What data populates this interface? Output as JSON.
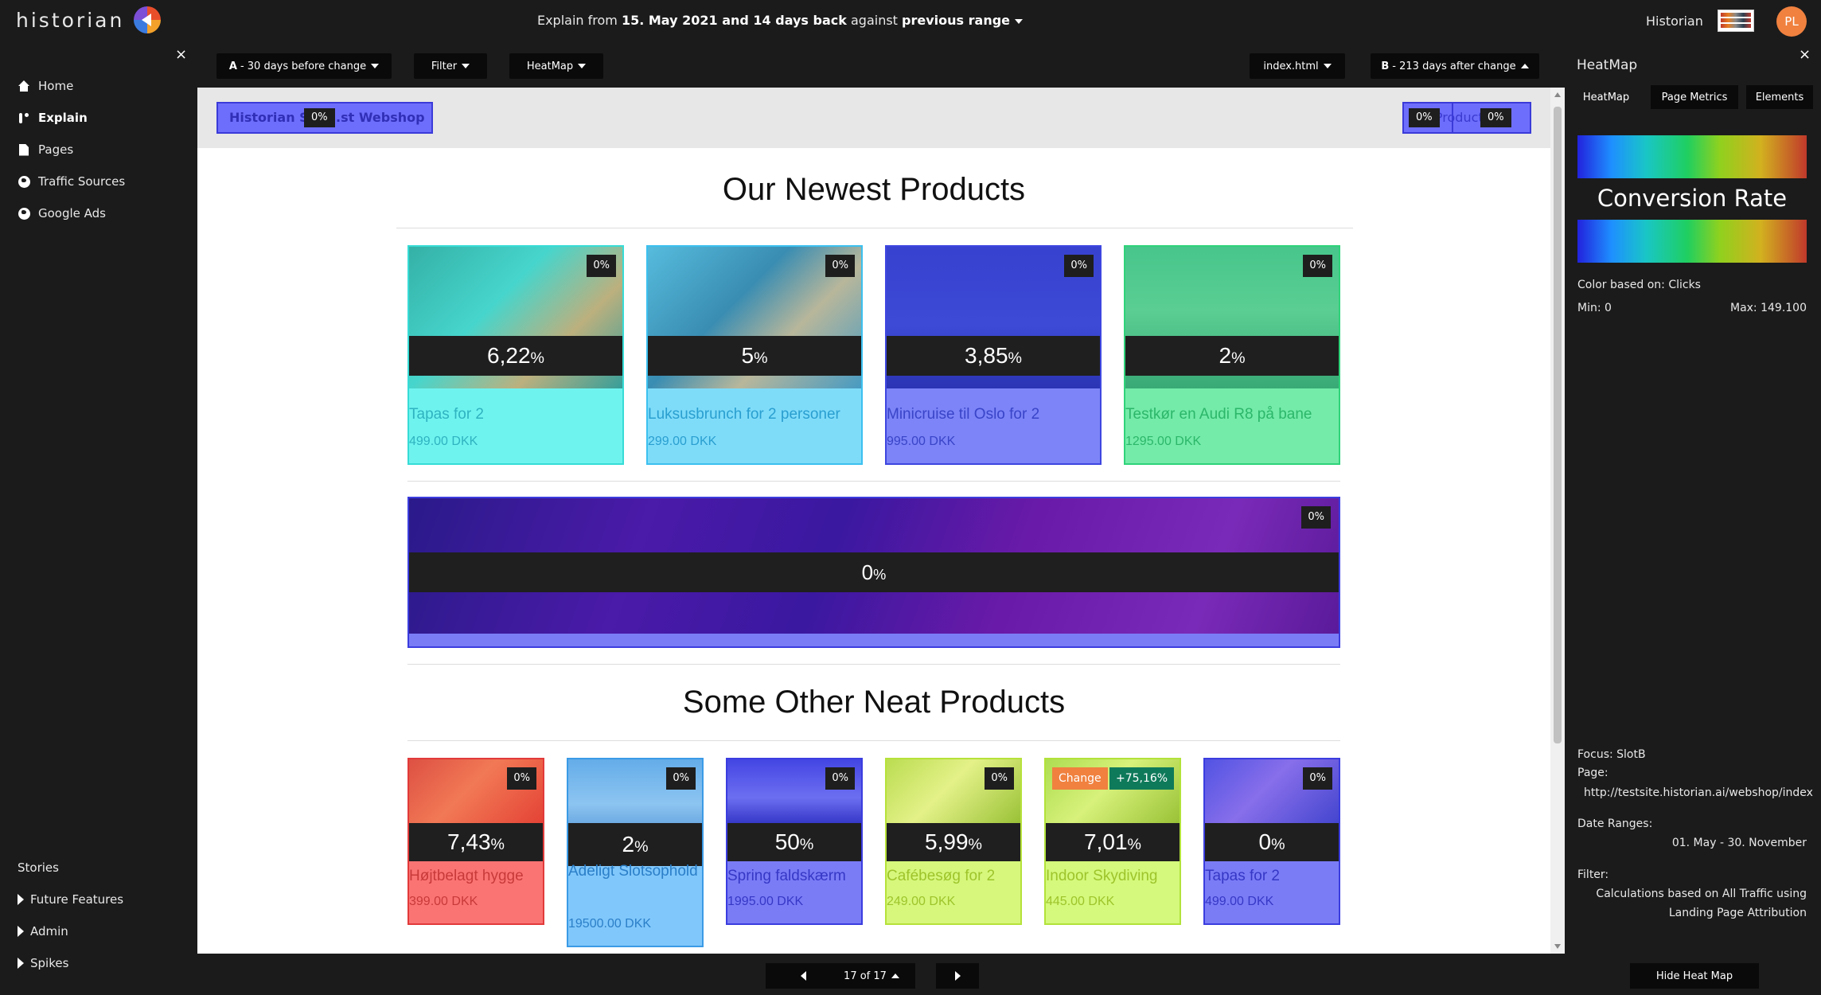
{
  "brand": {
    "name": "historian"
  },
  "topbar": {
    "explain_prefix": "Explain from ",
    "explain_date": "15. May 2021 and 14 days back",
    "explain_mid": " against ",
    "explain_range": "previous range",
    "user_label": "Historian",
    "avatar_initials": "PL"
  },
  "sidebar": {
    "close": "×",
    "items": [
      {
        "label": "Home",
        "icon": "home-icon"
      },
      {
        "label": "Explain",
        "icon": "branch-icon",
        "active": true
      },
      {
        "label": "Pages",
        "icon": "page-icon"
      },
      {
        "label": "Traffic Sources",
        "icon": "globe-icon"
      },
      {
        "label": "Google Ads",
        "icon": "globe-icon"
      }
    ],
    "stories_label": "Stories",
    "groups": [
      "Future Features",
      "Admin",
      "Spikes"
    ]
  },
  "toolbar": {
    "a_prefix": "A",
    "a_label": "- 30 days before change",
    "filter": "Filter",
    "heatmap": "HeatMap",
    "page_select": "index.html",
    "b_prefix": "B",
    "b_label": "- 213 days after change"
  },
  "shop": {
    "brand_label": "Historian Sim...st Webshop",
    "brand_pct": "0%",
    "all_products_label": "All Products",
    "all_products_pct_a": "0%",
    "all_products_pct_b": "0%",
    "section1_title": "Our Newest Products",
    "section2_title": "Some Other Neat Products",
    "banner": {
      "value": "0",
      "corner": "0%"
    },
    "newest": [
      {
        "title": "Tapas for 2",
        "price": "499.00 DKK",
        "value": "6,22",
        "corner": "0%",
        "fill": "#6ff3ef",
        "border": "#37dcd6",
        "text": "#2fb3c0"
      },
      {
        "title": "Luksusbrunch for 2 personer",
        "price": "299.00 DKK",
        "value": "5",
        "corner": "0%",
        "fill": "#7fdcf9",
        "border": "#3cc0ef",
        "text": "#2a9fd0"
      },
      {
        "title": "Minicruise til Oslo for 2",
        "price": "995.00 DKK",
        "value": "3,85",
        "corner": "0%",
        "fill": "#7c84f7",
        "border": "#3e46e0",
        "text": "#3944c8"
      },
      {
        "title": "Testkør en Audi R8 på bane",
        "price": "1295.00 DKK",
        "value": "2",
        "corner": "0%",
        "fill": "#74eba9",
        "border": "#2fd37a",
        "text": "#2cb76a"
      }
    ],
    "other": [
      {
        "title": "Højtbelagt hygge",
        "price": "399.00 DKK",
        "value": "7,43",
        "corner": "0%",
        "fill": "#fb7474",
        "border": "#e23a3a",
        "text": "#c83a3a"
      },
      {
        "title": "Adeligt Slotsophold",
        "price": "19500.00 DKK",
        "value": "2",
        "corner": "0%",
        "fill": "#80c7fb",
        "border": "#3b9be6",
        "text": "#2b7fc8"
      },
      {
        "title": "Spring faldskærm",
        "price": "1995.00 DKK",
        "value": "50",
        "corner": "0%",
        "fill": "#7a7cf6",
        "border": "#3b3ddf",
        "text": "#3638c6"
      },
      {
        "title": "Cafébesøg for 2",
        "price": "249.00 DKK",
        "value": "5,99",
        "corner": "0%",
        "fill": "#d6f77c",
        "border": "#b6e23a",
        "text": "#9ec42b"
      },
      {
        "title": "Indoor Skydiving",
        "price": "445.00 DKK",
        "value": "7,01",
        "corner": "",
        "change_label": "Change",
        "change_value": "+75,16%",
        "fill": "#d4f97c",
        "border": "#b2e23a",
        "text": "#9ec42b"
      },
      {
        "title": "Tapas for 2",
        "price": "499.00 DKK",
        "value": "0",
        "corner": "0%",
        "fill": "#7a7cf6",
        "border": "#3b3ddf",
        "text": "#3638c6"
      }
    ]
  },
  "rightpanel": {
    "title": "HeatMap",
    "close": "×",
    "tabs": [
      "HeatMap",
      "Page Metrics",
      "Elements"
    ],
    "legend_label": "Conversion Rate",
    "color_based": "Color based on: Clicks",
    "min": "Min: 0",
    "max": "Max: 149.100",
    "focus": "Focus: SlotB",
    "page_label": "Page:",
    "page_url": "http://testsite.historian.ai/webshop/index",
    "date_label": "Date Ranges:",
    "date_value": "01. May - 30. November",
    "filter_label": "Filter:",
    "filter_line1": "Calculations based on All Traffic using",
    "filter_line2": "Landing Page Attribution"
  },
  "pager": {
    "label": "17 of 17"
  },
  "hide_button": "Hide Heat Map",
  "pct_unit": "%"
}
